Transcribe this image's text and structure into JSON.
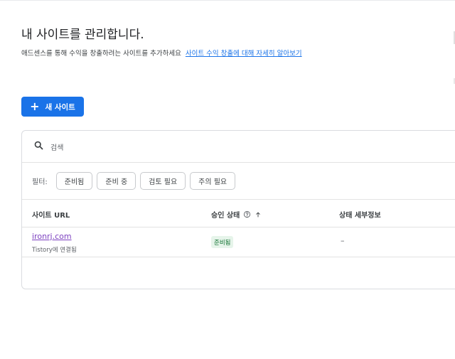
{
  "header": {
    "title": "내 사이트를 관리합니다.",
    "description": "애드센스를 통해 수익을 창출하려는 사이트를 추가하세요",
    "learn_more_link": "사이트 수익 창출에 대해 자세히 알아보기"
  },
  "toolbar": {
    "new_site_label": "새 사이트"
  },
  "search": {
    "placeholder": "검색"
  },
  "filters": {
    "label": "필터:",
    "chips": [
      "준비됨",
      "준비 중",
      "검토 필요",
      "주의 필요"
    ]
  },
  "table": {
    "columns": {
      "url": "사이트 URL",
      "status": "승인 상태",
      "detail": "상태 세부정보"
    },
    "rows": [
      {
        "site": "ironrj.com",
        "sub": "Tistory에 연결됨",
        "status": "준비됨",
        "detail": "–"
      }
    ]
  },
  "colors": {
    "accent": "#1a73e8",
    "visited_link": "#7b3fbf",
    "ready_badge_bg": "#e6f4ea",
    "ready_badge_text": "#137333"
  },
  "icons": {
    "search": "search-icon",
    "help": "help-icon",
    "sort": "arrow-up-icon",
    "add": "plus-icon"
  }
}
